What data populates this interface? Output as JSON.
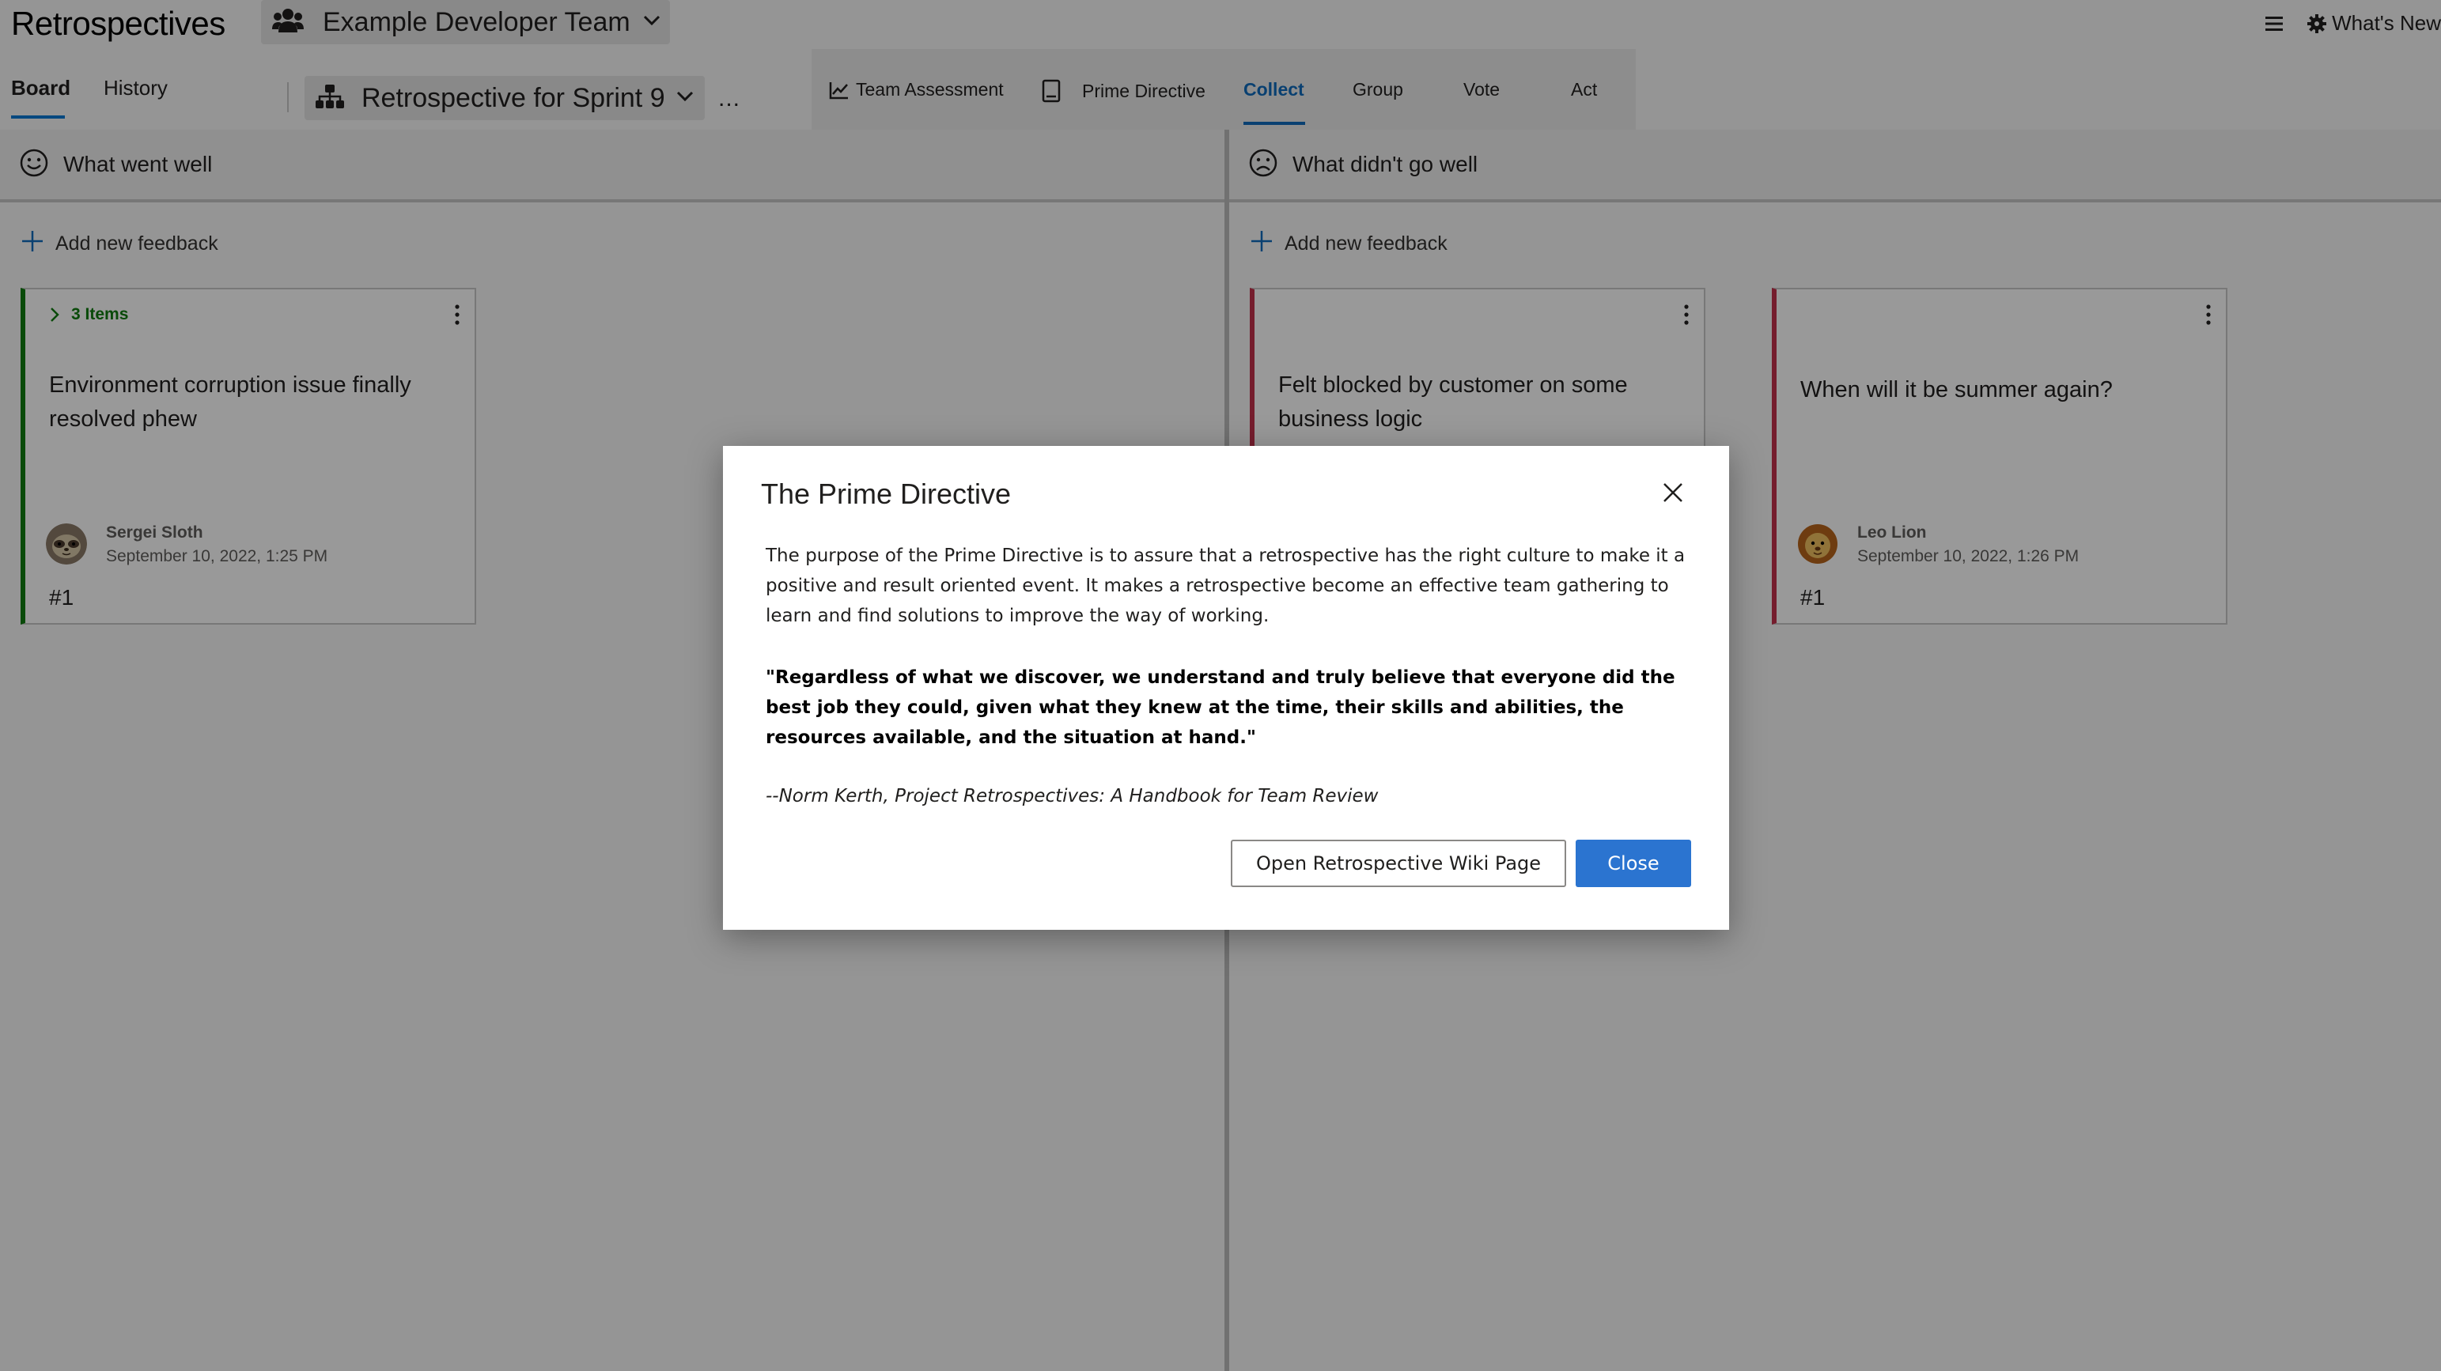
{
  "app": {
    "title": "Retrospectives"
  },
  "header": {
    "team_name": "Example Developer Team",
    "whats_new_label": "What's New"
  },
  "nav": {
    "tabs": [
      {
        "label": "Board",
        "active": true
      },
      {
        "label": "History",
        "active": false
      }
    ],
    "retro_name": "Retrospective for Sprint 9",
    "more_label": "..."
  },
  "phases": [
    {
      "label": "Team Assessment",
      "icon": "chart-icon"
    },
    {
      "label": "Prime Directive",
      "icon": "book-icon"
    },
    {
      "label": "Collect",
      "active": true
    },
    {
      "label": "Group"
    },
    {
      "label": "Vote"
    },
    {
      "label": "Act"
    }
  ],
  "columns": [
    {
      "title": "What went well",
      "icon": "smile-icon",
      "add_label": "Add new feedback",
      "cards": [
        {
          "group_label": "3 Items",
          "text": "Environment corruption issue finally resolved phew",
          "author": "Sergei Sloth",
          "date": "September 10, 2022, 1:25 PM",
          "number": "#1"
        }
      ]
    },
    {
      "title": "What didn't go well",
      "icon": "frown-icon",
      "add_label": "Add new feedback",
      "cards": [
        {
          "text": "Felt blocked by customer on some business logic"
        },
        {
          "text": "When will it be summer again?",
          "author": "Leo Lion",
          "date": "September 10, 2022, 1:26 PM",
          "number": "#1"
        }
      ]
    }
  ],
  "dialog": {
    "title": "The Prime Directive",
    "body": "The purpose of the Prime Directive is to assure that a retrospective has the right culture to make it a positive and result oriented event. It makes a retrospective become an effective team gathering to learn and find solutions to improve the way of working.",
    "quote": "\"Regardless of what we discover, we understand and truly believe that everyone did the best job they could, given what they knew at the time, their skills and abilities, the resources available, and the situation at hand.\"",
    "attribution": "--Norm Kerth, Project Retrospectives: A Handbook for Team Review",
    "wiki_button": "Open Retrospective Wiki Page",
    "close_button": "Close"
  },
  "colors": {
    "accent": "#0f6cbd",
    "primary_button": "#2b74d0",
    "went_well": "#107c10",
    "didnt_go_well": "#c4314b"
  }
}
